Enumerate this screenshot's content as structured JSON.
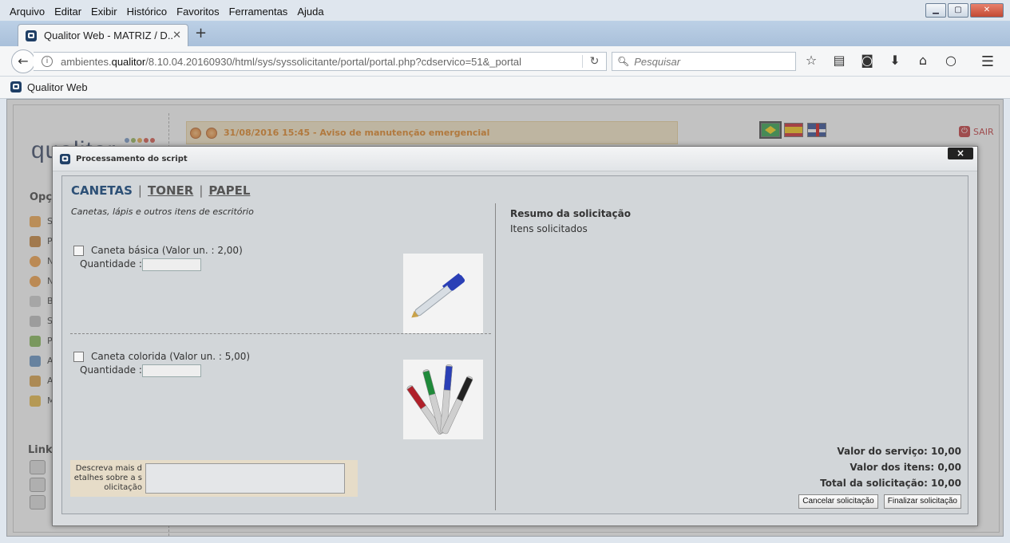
{
  "browser": {
    "menu": [
      "Arquivo",
      "Editar",
      "Exibir",
      "Histórico",
      "Favoritos",
      "Ferramentas",
      "Ajuda"
    ],
    "tab_title": "Qualitor Web - MATRIZ / D...",
    "url_prefix": "ambientes.",
    "url_domain": "qualitor",
    "url_rest": "/8.10.04.20160930/html/sys/syssolicitante/portal/portal.php?cdservico=51&_portal",
    "search_placeholder": "Pesquisar",
    "bookmark": "Qualitor Web"
  },
  "portal": {
    "logo_text": "qualitor",
    "options_heading": "Opçõe",
    "menu_items": [
      "So",
      "Pe",
      "No",
      "No",
      "Ba",
      "Se",
      "Pe",
      "Ate",
      "Alt",
      "Me"
    ],
    "links_heading": "Links",
    "notice": "31/08/2016 15:45 - Aviso de manutenção emergencial",
    "logout": "SAIR"
  },
  "dialog": {
    "title": "Processamento do script",
    "close": "×",
    "categories": [
      "CANETAS",
      "TONER",
      "PAPEL"
    ],
    "category_description": "Canetas, lápis e outros itens de escritório",
    "items": [
      {
        "name": "Caneta básica (Valor un. : 2,00)",
        "quantity_label": "Quantidade :",
        "quantity": ""
      },
      {
        "name": "Caneta colorida (Valor un. : 5,00)",
        "quantity_label": "Quantidade :",
        "quantity": ""
      }
    ],
    "details_label": "Descreva mais d etalhes sobre a s olicitação",
    "summary_title": "Resumo da solicitação",
    "summary_subtitle": "Itens solicitados",
    "service_value": "Valor do serviço: 10,00",
    "items_value": "Valor dos itens: 0,00",
    "total_value": "Total da solicitação: 10,00",
    "cancel_button": "Cancelar solicitação",
    "finish_button": "Finalizar solicitação"
  }
}
